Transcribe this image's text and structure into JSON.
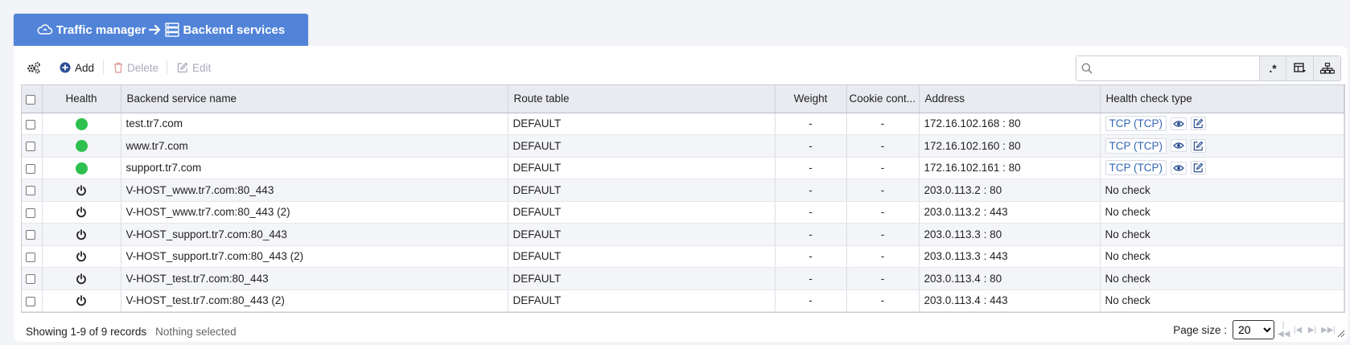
{
  "breadcrumb": {
    "parent": "Traffic manager",
    "current": "Backend services"
  },
  "toolbar": {
    "settings_icon": "gears-icon",
    "add_label": "Add",
    "delete_label": "Delete",
    "edit_label": "Edit",
    "search_placeholder": "",
    "search_value": ""
  },
  "table": {
    "columns": [
      "Health",
      "Backend service name",
      "Route table",
      "Weight",
      "Cookie cont...",
      "Address",
      "Health check type"
    ],
    "rows": [
      {
        "health": "up",
        "name": "test.tr7.com",
        "route": "DEFAULT",
        "weight": "-",
        "cookie": "-",
        "address": "172.16.102.168 : 80",
        "check": "TCP (TCP)"
      },
      {
        "health": "up",
        "name": "www.tr7.com",
        "route": "DEFAULT",
        "weight": "-",
        "cookie": "-",
        "address": "172.16.102.160 : 80",
        "check": "TCP (TCP)"
      },
      {
        "health": "up",
        "name": "support.tr7.com",
        "route": "DEFAULT",
        "weight": "-",
        "cookie": "-",
        "address": "172.16.102.161 : 80",
        "check": "TCP (TCP)"
      },
      {
        "health": "power",
        "name": "V-HOST_www.tr7.com:80_443",
        "route": "DEFAULT",
        "weight": "-",
        "cookie": "-",
        "address": "203.0.113.2 : 80",
        "check": "No check"
      },
      {
        "health": "power",
        "name": "V-HOST_www.tr7.com:80_443 (2)",
        "route": "DEFAULT",
        "weight": "-",
        "cookie": "-",
        "address": "203.0.113.2 : 443",
        "check": "No check"
      },
      {
        "health": "power",
        "name": "V-HOST_support.tr7.com:80_443",
        "route": "DEFAULT",
        "weight": "-",
        "cookie": "-",
        "address": "203.0.113.3 : 80",
        "check": "No check"
      },
      {
        "health": "power",
        "name": "V-HOST_support.tr7.com:80_443 (2)",
        "route": "DEFAULT",
        "weight": "-",
        "cookie": "-",
        "address": "203.0.113.3 : 443",
        "check": "No check"
      },
      {
        "health": "power",
        "name": "V-HOST_test.tr7.com:80_443",
        "route": "DEFAULT",
        "weight": "-",
        "cookie": "-",
        "address": "203.0.113.4 : 80",
        "check": "No check"
      },
      {
        "health": "power",
        "name": "V-HOST_test.tr7.com:80_443 (2)",
        "route": "DEFAULT",
        "weight": "-",
        "cookie": "-",
        "address": "203.0.113.4 : 443",
        "check": "No check"
      }
    ]
  },
  "footer": {
    "records": "Showing 1-9 of 9 records",
    "selection": "Nothing selected",
    "page_size_label": "Page size :",
    "page_size": "20"
  },
  "colors": {
    "accent": "#5183d8",
    "healthy": "#2ec04f",
    "link": "#3367b7"
  }
}
